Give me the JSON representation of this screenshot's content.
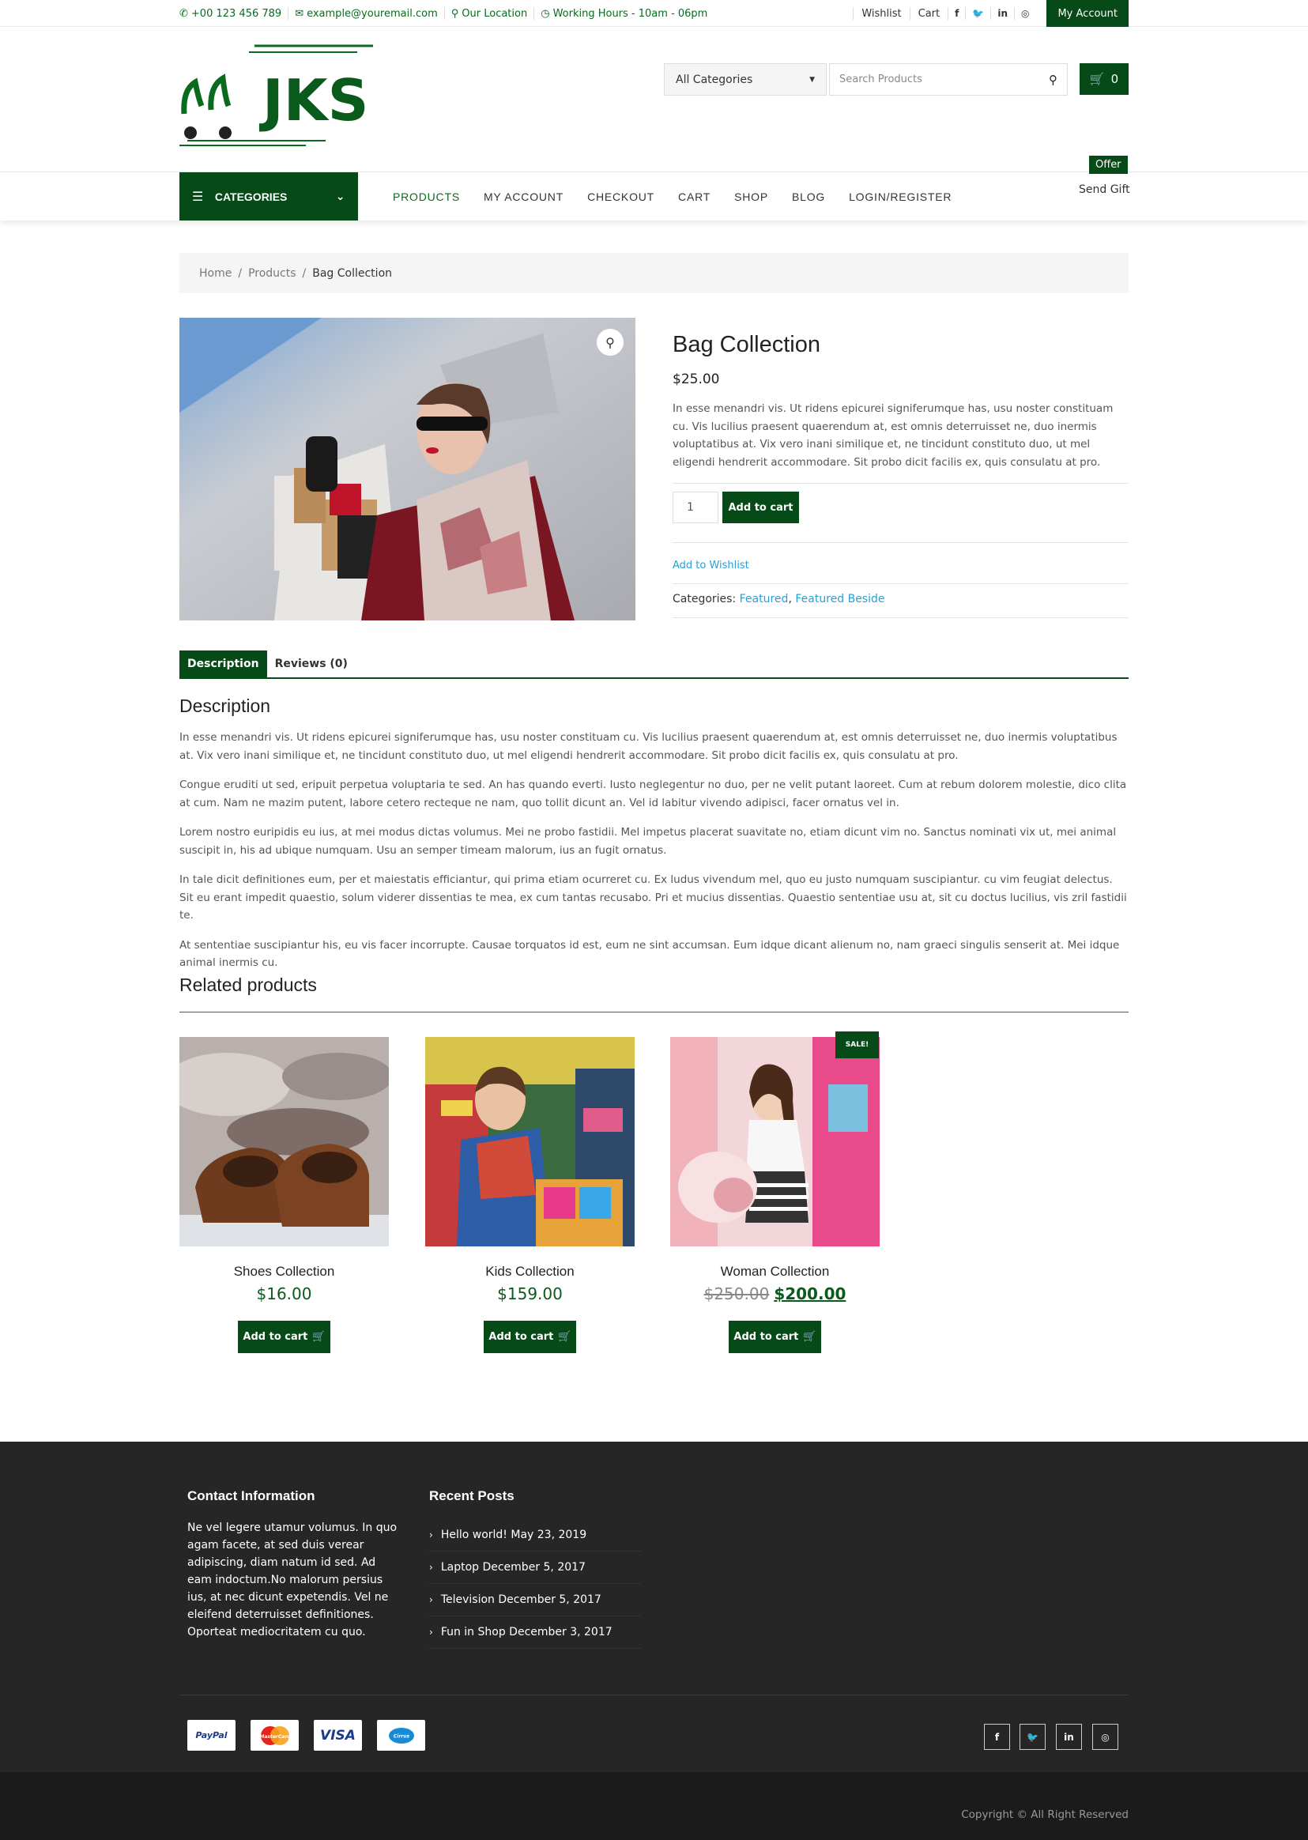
{
  "topbar": {
    "phone": "+00 123 456 789",
    "email": "example@youremail.com",
    "location": "Our Location",
    "hours": "Working Hours - 10am - 06pm",
    "wishlist": "Wishlist",
    "cart": "Cart",
    "social": [
      "f",
      "t",
      "in",
      "ig"
    ],
    "my_account": "My Account"
  },
  "header": {
    "logo_text": "JKS",
    "category_select": "All Categories",
    "search_placeholder": "Search Products",
    "cart_count": "0"
  },
  "nav": {
    "categories": "CATEGORIES",
    "items": [
      "PRODUCTS",
      "MY ACCOUNT",
      "CHECKOUT",
      "CART",
      "SHOP",
      "BLOG",
      "LOGIN/REGISTER"
    ],
    "offer_badge": "Offer",
    "send_gift": "Send Gift"
  },
  "breadcrumb": [
    "Home",
    "Products",
    "Bag Collection"
  ],
  "product": {
    "title": "Bag Collection",
    "price": "$25.00",
    "description": "In esse menandri vis. Ut ridens epicurei signiferumque has, usu noster constituam cu. Vis lucilius praesent quaerendum at, est omnis deterruisset ne, duo inermis voluptatibus at. Vix vero inani similique et, ne tincidunt constituto duo, ut mel eligendi hendrerit accommodare. Sit probo dicit facilis ex, quis consulatu at pro.",
    "quantity": "1",
    "add_to_cart": "Add to cart",
    "add_to_wishlist": "Add to Wishlist",
    "categories_label": "Categories:",
    "categories": [
      "Featured",
      "Featured Beside"
    ]
  },
  "tabs": [
    "Description",
    "Reviews (0)"
  ],
  "description": {
    "title": "Description",
    "paragraphs": [
      "In esse menandri vis. Ut ridens epicurei signiferumque has, usu noster constituam cu. Vis lucilius praesent quaerendum at, est omnis deterruisset ne, duo inermis voluptatibus at. Vix vero inani similique et, ne tincidunt constituto duo, ut mel eligendi hendrerit accommodare. Sit probo dicit facilis ex, quis consulatu at pro.",
      "Congue eruditi ut sed, eripuit perpetua voluptaria te sed. An has quando everti. Iusto neglegentur no duo, per ne velit putant laoreet. Cum at rebum dolorem molestie, dico clita at cum. Nam ne mazim putent, labore cetero recteque ne nam, quo tollit dicunt an. Vel id labitur vivendo adipisci, facer ornatus vel in.",
      "Lorem nostro euripidis eu ius, at mei modus dictas volumus. Mei ne probo fastidii. Mel impetus placerat suavitate no, etiam dicunt vim no. Sanctus nominati vix ut, mei animal suscipit in, his ad ubique numquam. Usu an semper timeam malorum, ius an fugit ornatus.",
      "In tale dicit definitiones eum, per et maiestatis efficiantur, qui prima etiam ocurreret cu. Ex ludus vivendum mel, quo eu justo numquam suscipiantur. cu vim feugiat delectus. Sit eu erant impedit quaestio, solum viderer dissentias te mea, ex cum tantas recusabo. Pri et mucius dissentias. Quaestio sententiae usu at, sit cu doctus lucilius, vis zril fastidii te.",
      "At sententiae suscipiantur his, eu vis facer incorrupte. Causae torquatos id est, eum ne sint accumsan. Eum idque dicant alienum no, nam graeci singulis senserit at. Mei idque animal inermis cu."
    ]
  },
  "related": {
    "title": "Related products",
    "items": [
      {
        "name": "Shoes Collection",
        "price": "$16.00",
        "button": "Add to cart"
      },
      {
        "name": "Kids Collection",
        "price": "$159.00",
        "button": "Add to cart"
      },
      {
        "name": "Woman Collection",
        "old_price": "$250.00",
        "price": "$200.00",
        "button": "Add to cart",
        "badge": "SALE!"
      }
    ]
  },
  "footer": {
    "contact_title": "Contact Information",
    "contact_text": "Ne vel legere utamur volumus. In quo agam facete, at sed duis verear adipiscing, diam natum id sed. Ad eam indoctum.No malorum persius ius, at nec dicunt expetendis. Vel ne eleifend deterruisset definitiones. Oporteat mediocritatem cu quo.",
    "posts_title": "Recent Posts",
    "posts": [
      "Hello world! May 23, 2019",
      "Laptop December 5, 2017",
      "Television December 5, 2017",
      "Fun in Shop December 3, 2017"
    ],
    "payments": [
      "PayPal",
      "MasterCard",
      "VISA",
      "Cirrus"
    ],
    "social": [
      "f",
      "t",
      "in",
      "ig"
    ],
    "copyright": "Copyright © All Right Reserved"
  },
  "colors": {
    "brand": "#064a17",
    "link": "#2a9fd6",
    "footer": "#262626"
  }
}
